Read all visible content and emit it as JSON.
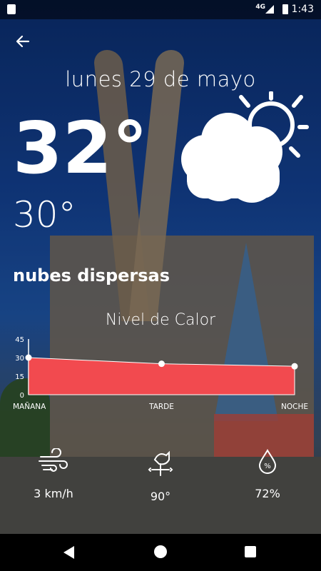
{
  "status_bar": {
    "network": "4G",
    "time": "1:43"
  },
  "header": {
    "back_icon": "arrow-left-icon",
    "date": "lunes 29 de mayo"
  },
  "current": {
    "temp_max": "32°",
    "temp_min": "30°",
    "condition": "nubes dispersas",
    "icon": "partly-cloudy-icon"
  },
  "heat_chart": {
    "title": "Nivel de Calor"
  },
  "chart_data": {
    "type": "area",
    "categories": [
      "MAÑANA",
      "TARDE",
      "NOCHE"
    ],
    "series": [
      {
        "values": [
          30,
          25,
          23
        ]
      }
    ],
    "y_ticks": [
      "0",
      "15",
      "30",
      "45"
    ],
    "ylim": [
      0,
      45
    ],
    "fill_color": "#f24a4f",
    "title": "Nivel de Calor"
  },
  "metrics": [
    {
      "icon": "wind-icon",
      "value": "3 km/h"
    },
    {
      "icon": "weathervane-icon",
      "value": "90°"
    },
    {
      "icon": "humidity-drop-icon",
      "value": "72%"
    }
  ],
  "nav_bar": {
    "back_icon": "nav-back-icon",
    "home_icon": "nav-home-icon",
    "recent_icon": "nav-recent-icon"
  },
  "colors": {
    "accent": "#f24a4f",
    "text": "#ffffff"
  }
}
